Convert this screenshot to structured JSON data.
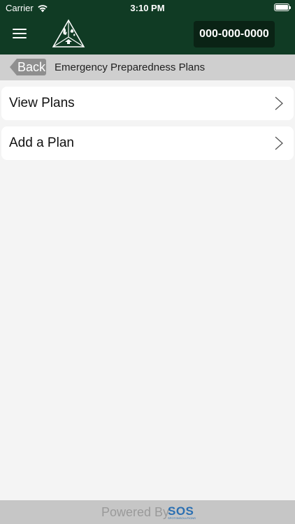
{
  "status_bar": {
    "carrier": "Carrier",
    "time": "3:10 PM",
    "wifi_icon": "wifi-icon",
    "battery_icon": "battery-icon"
  },
  "header": {
    "menu_icon": "hamburger-menu-icon",
    "logo_icon": "fire-safety-triangle-logo",
    "phone": "000-000-0000",
    "background_color": "#103b24",
    "phone_button_color": "#0a2315"
  },
  "subheader": {
    "back_label": "Back",
    "title": "Emergency Preparedness Plans",
    "background_color": "#cfcfcf"
  },
  "menu": {
    "items": [
      {
        "label": "View Plans",
        "icon": "chevron-right-icon"
      },
      {
        "label": "Add a Plan",
        "icon": "chevron-right-icon"
      }
    ]
  },
  "footer": {
    "powered_by": "Powered By",
    "brand": "SOS",
    "brand_sub": "SPOTONSOLUTIONS",
    "brand_color": "#2a6fb2"
  }
}
